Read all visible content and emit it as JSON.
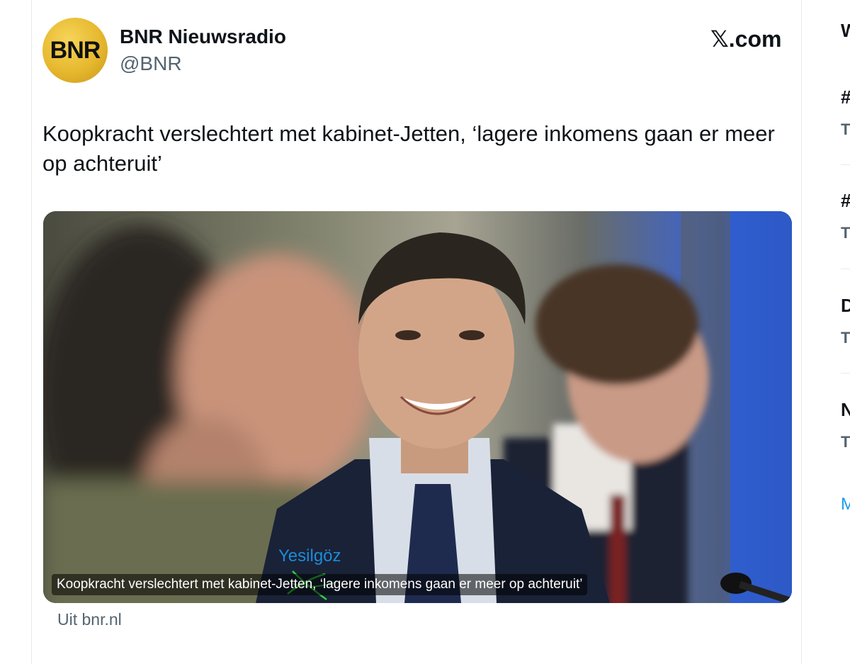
{
  "tweet": {
    "avatar_text": "BNR",
    "display_name": "BNR Nieuwsradio",
    "handle": "@BNR",
    "site": "𝕏.com",
    "text": "Koopkracht verslechtert met kabinet-Jetten, ‘lagere inkomens gaan er meer op achteruit’",
    "image_caption": "Koopkracht verslechtert met kabinet-Jetten, ‘lagere inkomens gaan er meer op achteruit’",
    "handwritten_annotation": "Yesilgöz",
    "source": "Uit bnr.nl"
  },
  "right_column": {
    "heading": "W",
    "items": [
      {
        "title": "#",
        "sub": "T"
      },
      {
        "title": "#",
        "sub": "T"
      },
      {
        "title": "D",
        "sub": "T"
      },
      {
        "title": "N",
        "sub": "T"
      }
    ],
    "more": "M"
  },
  "colors": {
    "text": "#0f1419",
    "secondary": "#536471",
    "link": "#1d9bf0",
    "annotation": "#1b8cd6",
    "annotation_strike": "#2fd13a",
    "avatar_gold": "#e6b82e"
  }
}
